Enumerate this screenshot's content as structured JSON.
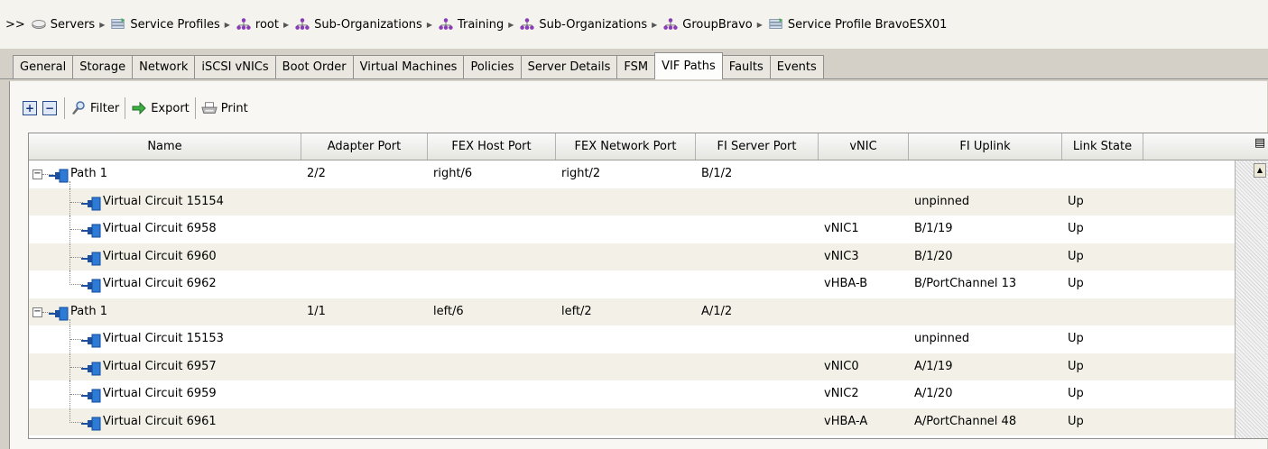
{
  "breadcrumb": {
    "prefix": ">>",
    "items": [
      {
        "label": "Servers",
        "icon": "server-icon"
      },
      {
        "label": "Service Profiles",
        "icon": "service-profile-icon"
      },
      {
        "label": "root",
        "icon": "organization-icon"
      },
      {
        "label": "Sub-Organizations",
        "icon": "organization-icon"
      },
      {
        "label": "Training",
        "icon": "organization-icon"
      },
      {
        "label": "Sub-Organizations",
        "icon": "organization-icon"
      },
      {
        "label": "GroupBravo",
        "icon": "organization-icon"
      },
      {
        "label": "Service Profile BravoESX01",
        "icon": "service-profile-icon"
      }
    ]
  },
  "tabs": [
    {
      "label": "General"
    },
    {
      "label": "Storage"
    },
    {
      "label": "Network"
    },
    {
      "label": "iSCSI vNICs"
    },
    {
      "label": "Boot Order"
    },
    {
      "label": "Virtual Machines"
    },
    {
      "label": "Policies"
    },
    {
      "label": "Server Details"
    },
    {
      "label": "FSM"
    },
    {
      "label": "VIF Paths",
      "active": true
    },
    {
      "label": "Faults"
    },
    {
      "label": "Events"
    }
  ],
  "toolbar": {
    "filter_label": "Filter",
    "export_label": "Export",
    "print_label": "Print"
  },
  "table": {
    "columns": [
      "Name",
      "Adapter Port",
      "FEX Host Port",
      "FEX Network Port",
      "FI Server Port",
      "vNIC",
      "FI Uplink",
      "Link State"
    ],
    "rows": [
      {
        "level": 0,
        "name": "Path 1",
        "cells": [
          "2/2",
          "right/6",
          "right/2",
          "B/1/2",
          "",
          "",
          ""
        ]
      },
      {
        "level": 1,
        "name": "Virtual Circuit 15154",
        "cells": [
          "",
          "",
          "",
          "",
          "",
          "unpinned",
          "Up"
        ]
      },
      {
        "level": 1,
        "name": "Virtual Circuit 6958",
        "cells": [
          "",
          "",
          "",
          "",
          "vNIC1",
          "B/1/19",
          "Up"
        ]
      },
      {
        "level": 1,
        "name": "Virtual Circuit 6960",
        "cells": [
          "",
          "",
          "",
          "",
          "vNIC3",
          "B/1/20",
          "Up"
        ]
      },
      {
        "level": 1,
        "last": true,
        "name": "Virtual Circuit 6962",
        "cells": [
          "",
          "",
          "",
          "",
          "vHBA-B",
          "B/PortChannel 13",
          "Up"
        ]
      },
      {
        "level": 0,
        "name": "Path 1",
        "cells": [
          "1/1",
          "left/6",
          "left/2",
          "A/1/2",
          "",
          "",
          ""
        ]
      },
      {
        "level": 1,
        "name": "Virtual Circuit 15153",
        "cells": [
          "",
          "",
          "",
          "",
          "",
          "unpinned",
          "Up"
        ]
      },
      {
        "level": 1,
        "name": "Virtual Circuit 6957",
        "cells": [
          "",
          "",
          "",
          "",
          "vNIC0",
          "A/1/19",
          "Up"
        ]
      },
      {
        "level": 1,
        "name": "Virtual Circuit 6959",
        "cells": [
          "",
          "",
          "",
          "",
          "vNIC2",
          "A/1/20",
          "Up"
        ]
      },
      {
        "level": 1,
        "last": true,
        "name": "Virtual Circuit 6961",
        "cells": [
          "",
          "",
          "",
          "",
          "vHBA-A",
          "A/PortChannel 48",
          "Up"
        ]
      }
    ]
  },
  "colors": {
    "link_icon": "#2e7bd6",
    "row_alt": "#f3f1e7"
  }
}
